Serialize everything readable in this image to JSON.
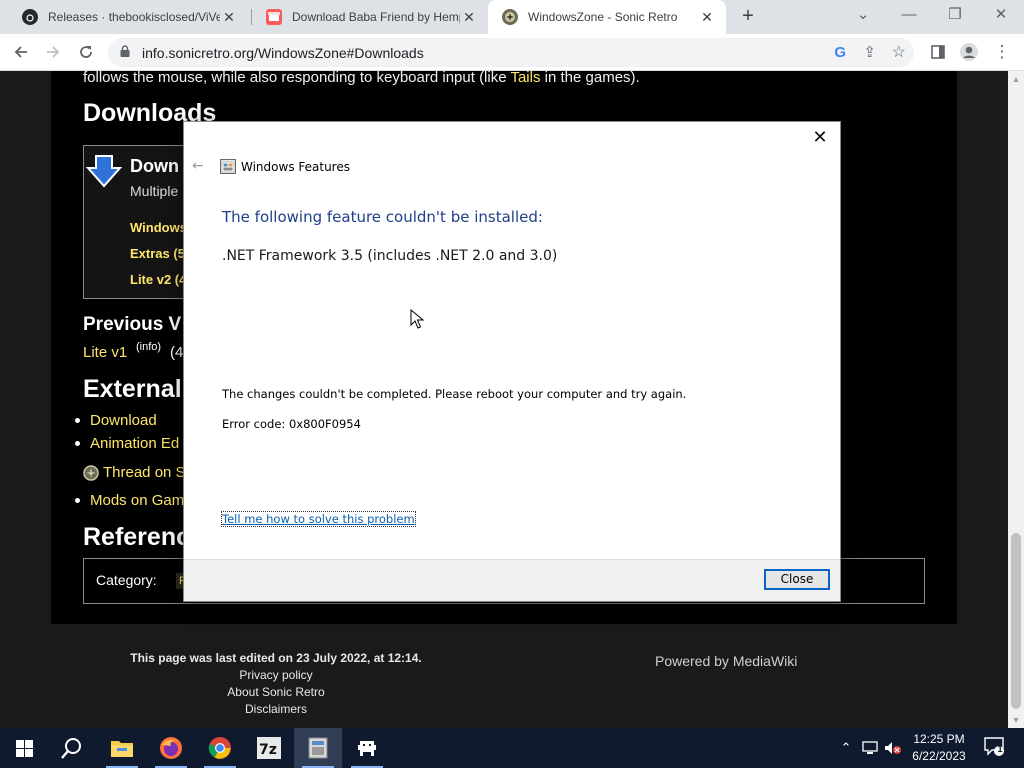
{
  "browser": {
    "tabs": [
      {
        "title": "Releases · thebookisclosed/ViVe",
        "favicon": "github-icon",
        "active": false
      },
      {
        "title": "Download Baba Friend by Hempuli",
        "favicon": "itchio-icon",
        "active": false
      },
      {
        "title": "WindowsZone - Sonic Retro",
        "favicon": "sonic-retro-icon",
        "active": true
      }
    ],
    "url": "info.sonicretro.org/WindowsZone#Downloads"
  },
  "page": {
    "intro_text_a": "follows the mouse, while also responding to keyboard input (like ",
    "intro_link": "Tails",
    "intro_text_b": " in the games).",
    "downloads_heading": "Downloads",
    "download_box": {
      "title": "Down",
      "subtitle": "Multiple",
      "links": [
        "Windows",
        "Extras (5",
        "Lite v2 (4"
      ]
    },
    "previous_heading": "Previous V",
    "previous_link": "Lite v1",
    "previous_info": "(info)",
    "previous_suffix": "(4",
    "external_heading": "External",
    "external_links": [
      "Download",
      "Animation Ed",
      "Thread on S",
      "Mods on Gam"
    ],
    "references_heading": "Referenc",
    "category_label": "Category:",
    "category_value": "F",
    "footer_last_edited": "This page was last edited on 23 July 2022, at 12:14.",
    "footer_privacy": "Privacy policy",
    "footer_about": "About Sonic Retro",
    "footer_disclaimers": "Disclaimers",
    "powered_by": "Powered by MediaWiki"
  },
  "dialog": {
    "title": "Windows Features",
    "heading": "The following feature couldn't be installed:",
    "feature": ".NET Framework 3.5 (includes .NET 2.0 and 3.0)",
    "message": "The changes couldn't be completed. Please reboot your computer and try again.",
    "error_code": "Error code: 0x800F0954",
    "help_link": "Tell me how to solve this problem",
    "close_button": "Close"
  },
  "taskbar": {
    "apps": [
      "start-icon",
      "search-icon",
      "file-explorer-icon",
      "firefox-icon",
      "chrome-icon",
      "7zip-icon",
      "windows-features-icon",
      "game-icon"
    ],
    "time": "12:25 PM",
    "date": "6/22/2023",
    "notification_count": "1"
  },
  "colors": {
    "link_yellow": "#ffe56b",
    "dialog_heading": "#1f3f8a",
    "taskbar": "#0f1a2e",
    "accent_blue": "#0a64c8"
  }
}
